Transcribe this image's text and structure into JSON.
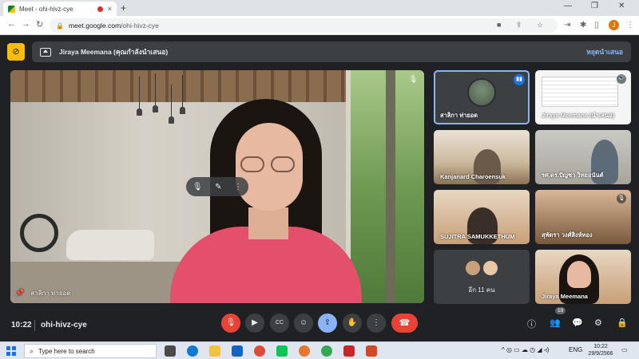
{
  "browser": {
    "tab_title": "Meet - ohi-hivz-cye",
    "tab_close": "×",
    "new_tab": "+",
    "url_host": "meet.google.com",
    "url_path": "/ohi-hivz-cye",
    "profile_initial": "J",
    "min_glyph": "—",
    "max_glyph": "❐",
    "close_glyph": "✕",
    "back_glyph": "←",
    "forward_glyph": "→",
    "reload_glyph": "↻",
    "lock_glyph": "🔒",
    "omni_icons": "■ ⇪ ☆",
    "ext_glyphs": [
      "⇥",
      "✱",
      "▯",
      "⋮"
    ]
  },
  "presentation_bar": {
    "presenter_label": "Jiraya Meemana (คุณกำลังนำเสนอ)",
    "stop_label": "หยุดนำเสนอ",
    "cam_glyph": "⊘"
  },
  "main_video": {
    "name": "สาลิกา ท่ายอด",
    "pin_glyph": "📌",
    "mute_glyph": "🎙",
    "hover_mute_glyph": "🎙",
    "hover_pin_glyph": "✎",
    "hover_more_glyph": "⋮"
  },
  "tiles": [
    {
      "name": "สาลิกา ท่ายอด",
      "indicator": "▮▮",
      "active": true
    },
    {
      "name": "Jiraya Meemana (นำเสนอ)",
      "indicator": "🔊"
    },
    {
      "name": "Kanjanard Charoensuk",
      "indicator": ""
    },
    {
      "name": "รศ.ดร.ปัญชา วิทยอนันต์",
      "indicator": ""
    },
    {
      "name": "SUJITRA SAMUKKETHUM",
      "indicator": ""
    },
    {
      "name": "สุพัตรา วงศ์สิงห์ทอง",
      "indicator": "🎙"
    },
    {
      "name": "อีก 11 คน",
      "indicator": ""
    },
    {
      "name": "Jiraya Meemana",
      "indicator": ""
    }
  ],
  "controls": {
    "time": "10:22",
    "meeting_code": "ohi-hivz-cye",
    "mic_glyph": "🎙",
    "cam_glyph": "▶",
    "cc_glyph": "CC",
    "emoji_glyph": "☺",
    "present_glyph": "⇪",
    "hand_glyph": "✋",
    "more_glyph": "⋮",
    "end_glyph": "☎",
    "info_glyph": "ⓘ",
    "people_glyph": "👥",
    "chat_glyph": "💬",
    "activities_glyph": "⚙",
    "host_glyph": "🔒",
    "participants_count": "19"
  },
  "taskbar": {
    "search_placeholder": "Type here to search",
    "search_glyph": "⌕",
    "lang": "ENG",
    "clock_time": "10:22",
    "clock_date": "29/9/2566",
    "tray_glyphs": "^ ◎ ▭ ☁ ◷ ◢ ◃)",
    "notif_glyph": "▭"
  },
  "colors": {
    "meet_bg": "#202124",
    "accent_blue": "#8ab4f8",
    "end_red": "#ea4335",
    "cam_off_yellow": "#fbbc04"
  }
}
